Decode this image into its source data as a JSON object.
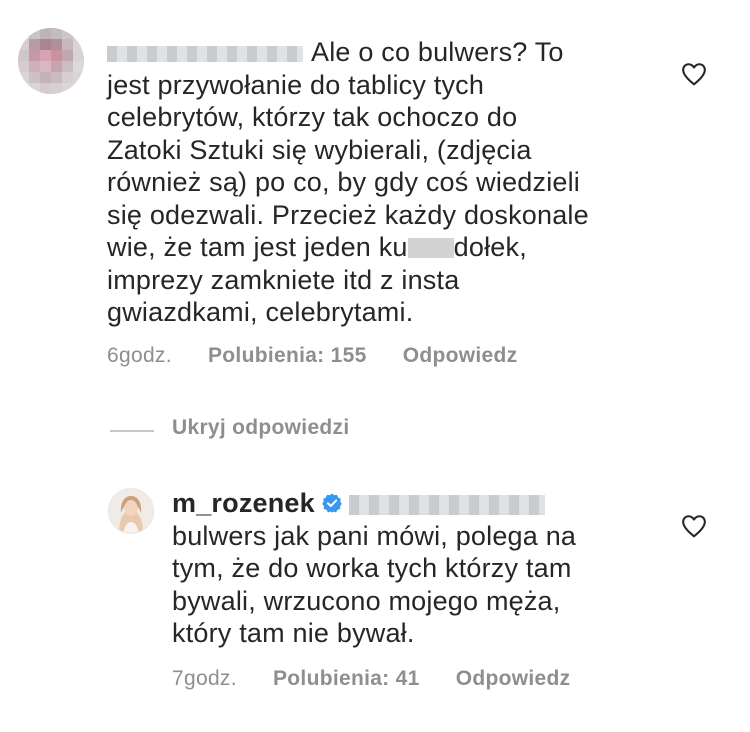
{
  "comments": [
    {
      "lines": [
        "Ale o co bulwers?  To",
        "jest przywołanie do tablicy tych",
        "celebrytów,  którzy tak ochoczo do",
        "Zatoki Sztuki się wybierali, (zdjęcia",
        "również są) po co,  by gdy coś wiedzieli",
        "się odezwali. Przecież każdy doskonale",
        "wie,  że tam jest jeden ku",
        "dołek,",
        "imprezy zamkniete itd z insta",
        "gwiazdkami,  celebrytami."
      ],
      "time": "6godz.",
      "likes": "Polubienia: 155",
      "reply_label": "Odpowiedz"
    }
  ],
  "toggle_replies_label": "Ukryj odpowiedzi",
  "reply": {
    "username": "m_rozenek",
    "lines": [
      "bulwers jak pani mówi, polega na",
      "tym, że do worka tych którzy tam",
      "bywali, wrzucono mojego męża,",
      "który tam nie bywał."
    ],
    "time": "7godz.",
    "likes": "Polubienia: 41",
    "reply_label": "Odpowiedz"
  },
  "icons": {
    "like": "heart-outline-icon",
    "verified": "verified-badge-icon"
  },
  "colors": {
    "text": "#262626",
    "meta": "#8e8e8e",
    "verified": "#3897f0"
  }
}
